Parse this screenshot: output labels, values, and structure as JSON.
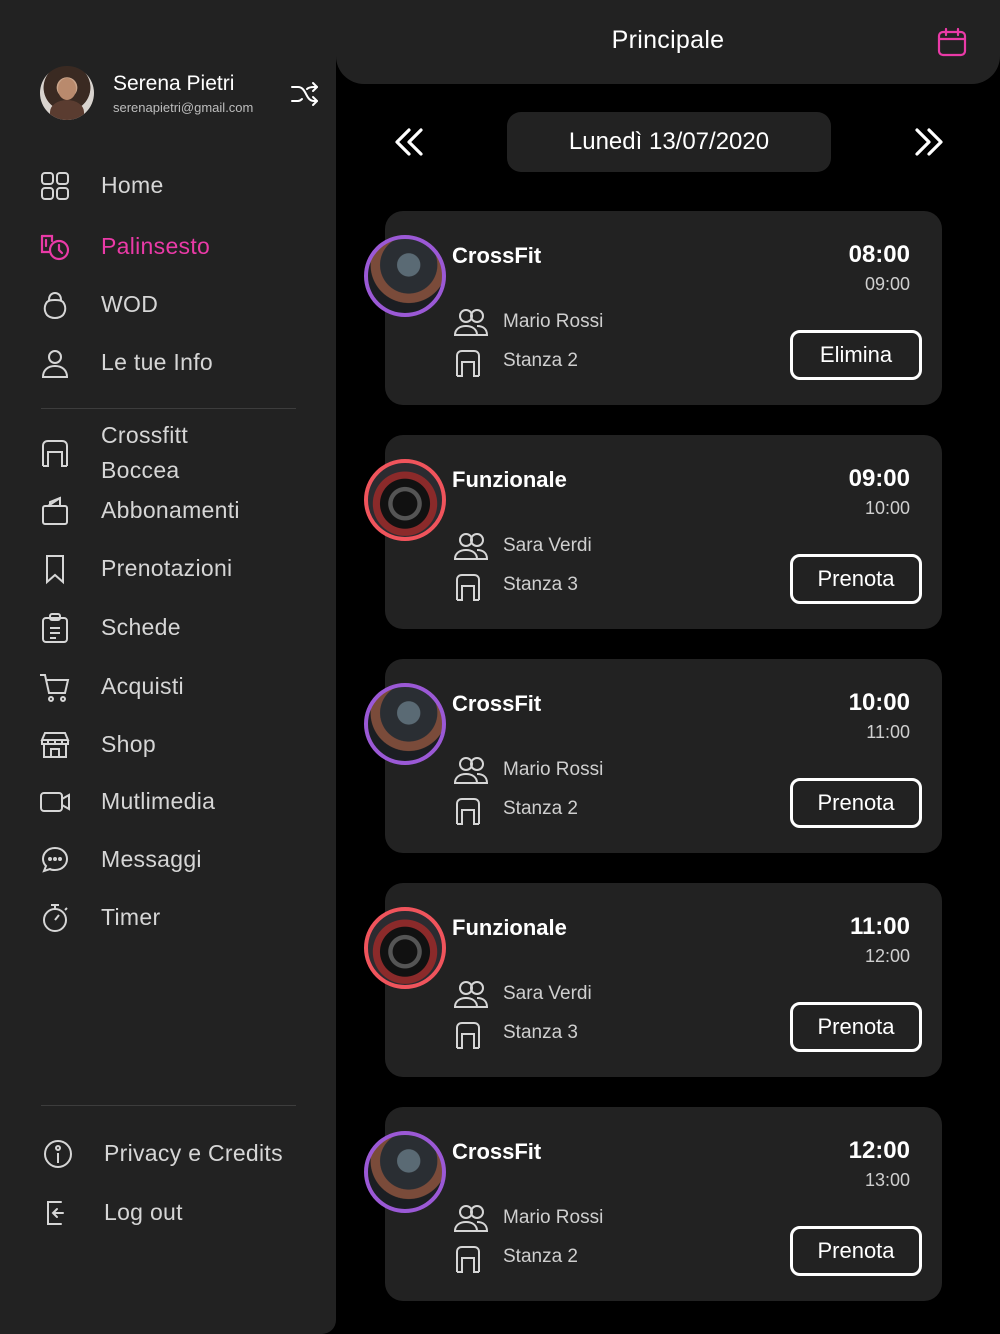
{
  "header": {
    "title": "Principale",
    "calendar_icon": "calendar-icon",
    "accent": "#ea3aa7"
  },
  "profile": {
    "name": "Serena Pietri",
    "email": "serenapietri@gmail.com"
  },
  "menu": {
    "items": [
      {
        "label": "Home",
        "icon": "grid-icon"
      },
      {
        "label": "Palinsesto",
        "icon": "schedule-icon",
        "active": true
      },
      {
        "label": "WOD",
        "icon": "kettlebell-icon"
      },
      {
        "label": "Le tue Info",
        "icon": "user-icon"
      }
    ],
    "gym": {
      "line1": "Crossfitt",
      "line2": "Boccea"
    },
    "items2": [
      {
        "label": "Abbonamenti",
        "icon": "bag-icon"
      },
      {
        "label": "Prenotazioni",
        "icon": "bookmark-icon"
      },
      {
        "label": "Schede",
        "icon": "clipboard-icon"
      },
      {
        "label": "Acquisti",
        "icon": "cart-icon"
      },
      {
        "label": "Shop",
        "icon": "store-icon"
      },
      {
        "label": "Mutlimedia",
        "icon": "video-icon"
      },
      {
        "label": "Messaggi",
        "icon": "chat-icon"
      },
      {
        "label": "Timer",
        "icon": "stopwatch-icon"
      }
    ],
    "footer": [
      {
        "label": "Privacy e Credits",
        "icon": "info-icon"
      },
      {
        "label": "Log out",
        "icon": "logout-icon"
      }
    ]
  },
  "date": {
    "label": "Lunedì 13/07/2020"
  },
  "classes": [
    {
      "name": "CrossFit",
      "start": "08:00",
      "end": "09:00",
      "trainer": "Mario Rossi",
      "room": "Stanza 2",
      "action": "Elimina",
      "ring": "#9b59d6"
    },
    {
      "name": "Funzionale",
      "start": "09:00",
      "end": "10:00",
      "trainer": "Sara Verdi",
      "room": "Stanza 3",
      "action": "Prenota",
      "ring": "#f0545c"
    },
    {
      "name": "CrossFit",
      "start": "10:00",
      "end": "11:00",
      "trainer": "Mario Rossi",
      "room": "Stanza 2",
      "action": "Prenota",
      "ring": "#9b59d6"
    },
    {
      "name": "Funzionale",
      "start": "11:00",
      "end": "12:00",
      "trainer": "Sara Verdi",
      "room": "Stanza 3",
      "action": "Prenota",
      "ring": "#f0545c"
    },
    {
      "name": "CrossFit",
      "start": "12:00",
      "end": "13:00",
      "trainer": "Mario Rossi",
      "room": "Stanza 2",
      "action": "Prenota",
      "ring": "#9b59d6"
    }
  ]
}
